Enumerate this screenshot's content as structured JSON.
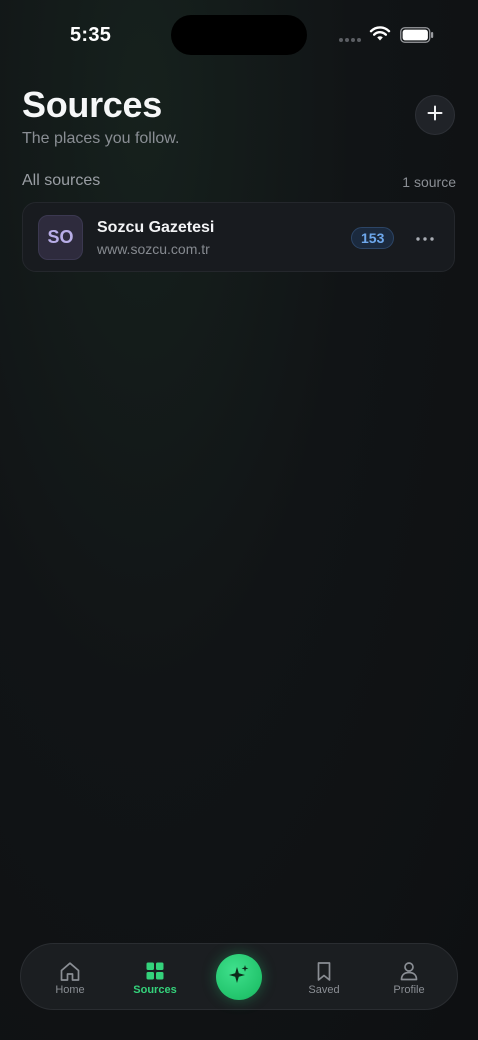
{
  "status_bar": {
    "time": "5:35"
  },
  "header": {
    "title": "Sources",
    "subtitle": "The places you follow.",
    "add_icon": "plus-icon"
  },
  "section": {
    "label": "All sources",
    "count": "1 source"
  },
  "sources": [
    {
      "initials": "SO",
      "name": "Sozcu Gazetesi",
      "url": "www.sozcu.com.tr",
      "count": "153",
      "more_icon": "ellipsis-icon"
    }
  ],
  "tab_bar": {
    "items": [
      {
        "label": "Home",
        "icon": "home-icon",
        "active": false
      },
      {
        "label": "Sources",
        "icon": "grid-icon",
        "active": true
      },
      {
        "label": "",
        "icon": "sparkle-icon",
        "active": false
      },
      {
        "label": "Saved",
        "icon": "bookmark-icon",
        "active": false
      },
      {
        "label": "Profile",
        "icon": "person-icon",
        "active": false
      }
    ]
  },
  "colors": {
    "accent": "#34d27b",
    "badge_text": "#6ea8ec",
    "background": "#0f1113",
    "avatar_text": "#b9aee8"
  }
}
